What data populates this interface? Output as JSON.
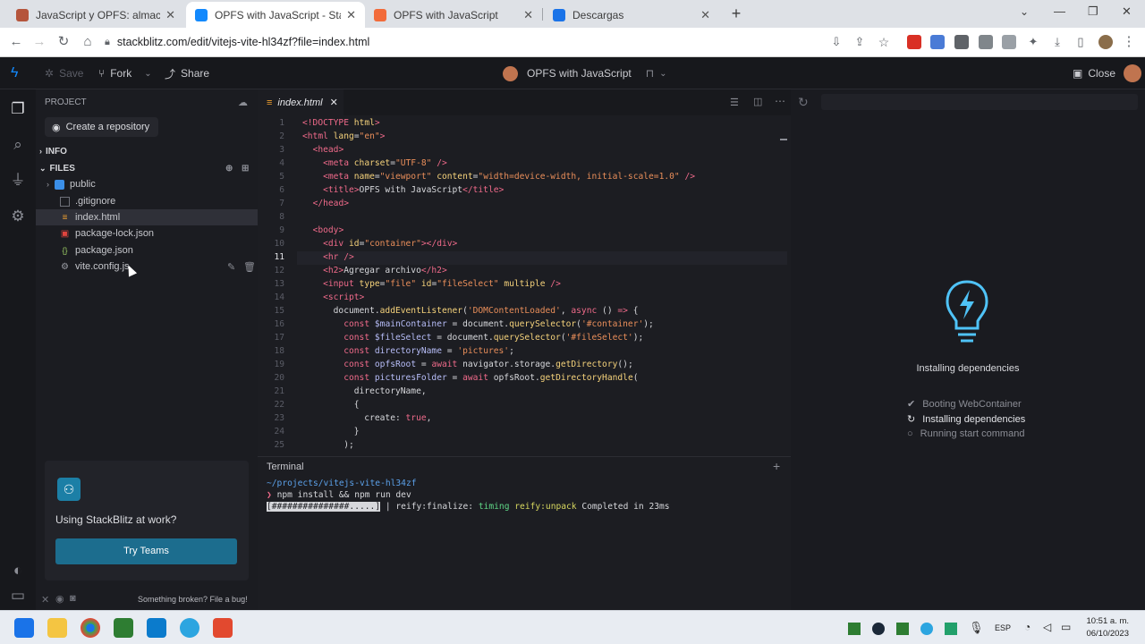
{
  "browser": {
    "tabs": [
      {
        "title": "JavaScript y OPFS: almacenar y l",
        "fav": "#b5553c"
      },
      {
        "title": "OPFS with JavaScript - StackBlitz",
        "fav": "#1389fd"
      },
      {
        "title": "OPFS with JavaScript",
        "fav": "#f26b3a"
      },
      {
        "title": "Descargas",
        "fav": "#1a73e8"
      }
    ],
    "new_tab": "+",
    "url": "stackblitz.com/edit/vitejs-vite-hl34zf?file=index.html"
  },
  "topbar": {
    "save": "Save",
    "fork": "Fork",
    "share": "Share",
    "project_title": "OPFS with JavaScript",
    "close": "Close"
  },
  "sidebar": {
    "project_heading": "PROJECT",
    "create_repo": "Create a repository",
    "info": "INFO",
    "files": "FILES",
    "tree": [
      {
        "name": "public",
        "kind": "folder"
      },
      {
        "name": ".gitignore",
        "kind": "file"
      },
      {
        "name": "index.html",
        "kind": "html"
      },
      {
        "name": "package-lock.json",
        "kind": "lock"
      },
      {
        "name": "package.json",
        "kind": "json"
      },
      {
        "name": "vite.config.js",
        "kind": "config"
      }
    ],
    "promo_text": "Using StackBlitz at work?",
    "promo_button": "Try Teams",
    "footer_text": "Something broken? File a bug!"
  },
  "editor": {
    "tab": "index.html",
    "line_numbers": [
      "1",
      "2",
      "3",
      "4",
      "5",
      "6",
      "7",
      "8",
      "9",
      "10",
      "11",
      "12",
      "13",
      "14",
      "15",
      "16",
      "17",
      "18",
      "19",
      "20",
      "21",
      "22",
      "23",
      "24",
      "25"
    ],
    "current_line": 11
  },
  "terminal": {
    "title": "Terminal",
    "path": "~/projects/vitejs-vite-hl34zf",
    "command": "npm install && npm run dev",
    "progress_bar": "[###############.....]",
    "progress_pipe": " | ",
    "progress_stage": "reify:finalize:",
    "progress_timing": "timing",
    "progress_unpack": "reify:unpack",
    "progress_done": "Completed in 23ms"
  },
  "preview": {
    "status": "Installing dependencies",
    "steps": [
      {
        "label": "Booting WebContainer",
        "state": "done"
      },
      {
        "label": "Installing dependencies",
        "state": "active"
      },
      {
        "label": "Running start command",
        "state": "pending"
      }
    ]
  },
  "taskbar": {
    "lang": "ESP",
    "time": "10:51 a. m.",
    "date": "06/10/2023"
  }
}
